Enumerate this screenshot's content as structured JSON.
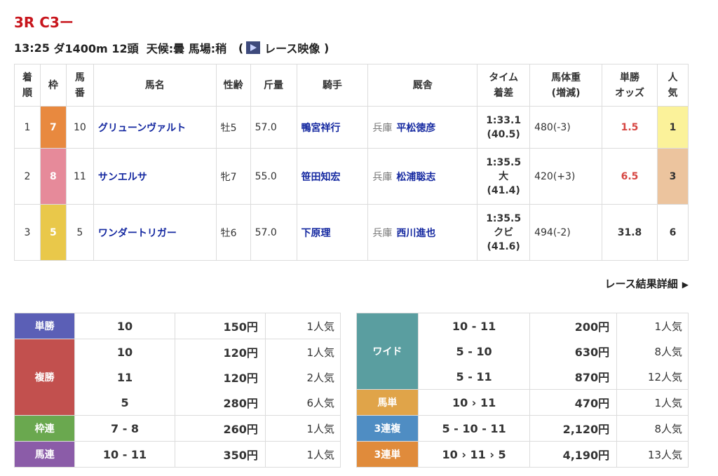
{
  "race": {
    "title": "3R C3ー",
    "time": "13:25",
    "course": "ダ1400m",
    "heads": "12頭",
    "weather": "天候:曇",
    "track": "馬場:稍",
    "video_open": "(",
    "video_label": "レース映像",
    "video_close": ")"
  },
  "headers": {
    "rank": "着順",
    "frame": "枠",
    "num": "馬番",
    "horse": "馬名",
    "sexage": "性齢",
    "weight": "斤量",
    "jockey": "騎手",
    "trainer": "厩舎",
    "time": "タイム着差",
    "bodyweight": "馬体重(増減)",
    "odds": "単勝オッズ",
    "pop": "人気"
  },
  "results": [
    {
      "rank": "1",
      "frame": "7",
      "frame_color": "#e8893f",
      "num": "10",
      "horse": "グリューンヴァルト",
      "sexage": "牡5",
      "weight": "57.0",
      "jockey": "鴨宮祥行",
      "pref": "兵庫",
      "trainer": "平松徳彦",
      "time": "1:33.1",
      "margin": "",
      "last": "(40.5)",
      "bodyweight": "480(-3)",
      "odds": "1.5",
      "pop": "1",
      "pop_color": "#fbf29a"
    },
    {
      "rank": "2",
      "frame": "8",
      "frame_color": "#e68a9a",
      "num": "11",
      "horse": "サンエルサ",
      "sexage": "牝7",
      "weight": "55.0",
      "jockey": "笹田知宏",
      "pref": "兵庫",
      "trainer": "松浦聡志",
      "time": "1:35.5",
      "margin": "大",
      "last": "(41.4)",
      "bodyweight": "420(+3)",
      "odds": "6.5",
      "pop": "3",
      "pop_color": "#ecc49e"
    },
    {
      "rank": "3",
      "frame": "5",
      "frame_color": "#e9c84a",
      "num": "5",
      "horse": "ワンダートリガー",
      "sexage": "牡6",
      "weight": "57.0",
      "jockey": "下原理",
      "pref": "兵庫",
      "trainer": "西川進也",
      "time": "1:35.5",
      "margin": "クビ",
      "last": "(41.6)",
      "bodyweight": "494(-2)",
      "odds": "31.8",
      "pop": "6",
      "pop_color": "#ffffff"
    }
  ],
  "detail_link": "レース結果詳細",
  "payouts_left": [
    {
      "type": "単勝",
      "color": "#5b5fb6",
      "rows": [
        {
          "combo": "10",
          "amount": "150円",
          "pop": "1人気"
        }
      ]
    },
    {
      "type": "複勝",
      "color": "#c2504e",
      "rows": [
        {
          "combo": "10",
          "amount": "120円",
          "pop": "1人気"
        },
        {
          "combo": "11",
          "amount": "120円",
          "pop": "2人気"
        },
        {
          "combo": "5",
          "amount": "280円",
          "pop": "6人気"
        }
      ]
    },
    {
      "type": "枠連",
      "color": "#6aa84f",
      "rows": [
        {
          "combo": "7 - 8",
          "amount": "260円",
          "pop": "1人気"
        }
      ]
    },
    {
      "type": "馬連",
      "color": "#8b5ca8",
      "rows": [
        {
          "combo": "10 - 11",
          "amount": "350円",
          "pop": "1人気"
        }
      ]
    }
  ],
  "payouts_right": [
    {
      "type": "ワイド",
      "color": "#5a9ea0",
      "rows": [
        {
          "combo": "10 - 11",
          "amount": "200円",
          "pop": "1人気"
        },
        {
          "combo": "5 - 10",
          "amount": "630円",
          "pop": "8人気"
        },
        {
          "combo": "5 - 11",
          "amount": "870円",
          "pop": "12人気"
        }
      ]
    },
    {
      "type": "馬単",
      "color": "#e0a449",
      "rows": [
        {
          "combo": "10 › 11",
          "amount": "470円",
          "pop": "1人気"
        }
      ]
    },
    {
      "type": "3連複",
      "color": "#4f8dc3",
      "rows": [
        {
          "combo": "5 - 10 - 11",
          "amount": "2,120円",
          "pop": "8人気"
        }
      ]
    },
    {
      "type": "3連単",
      "color": "#e08b3b",
      "rows": [
        {
          "combo": "10 › 11 › 5",
          "amount": "4,190円",
          "pop": "13人気"
        }
      ]
    }
  ]
}
